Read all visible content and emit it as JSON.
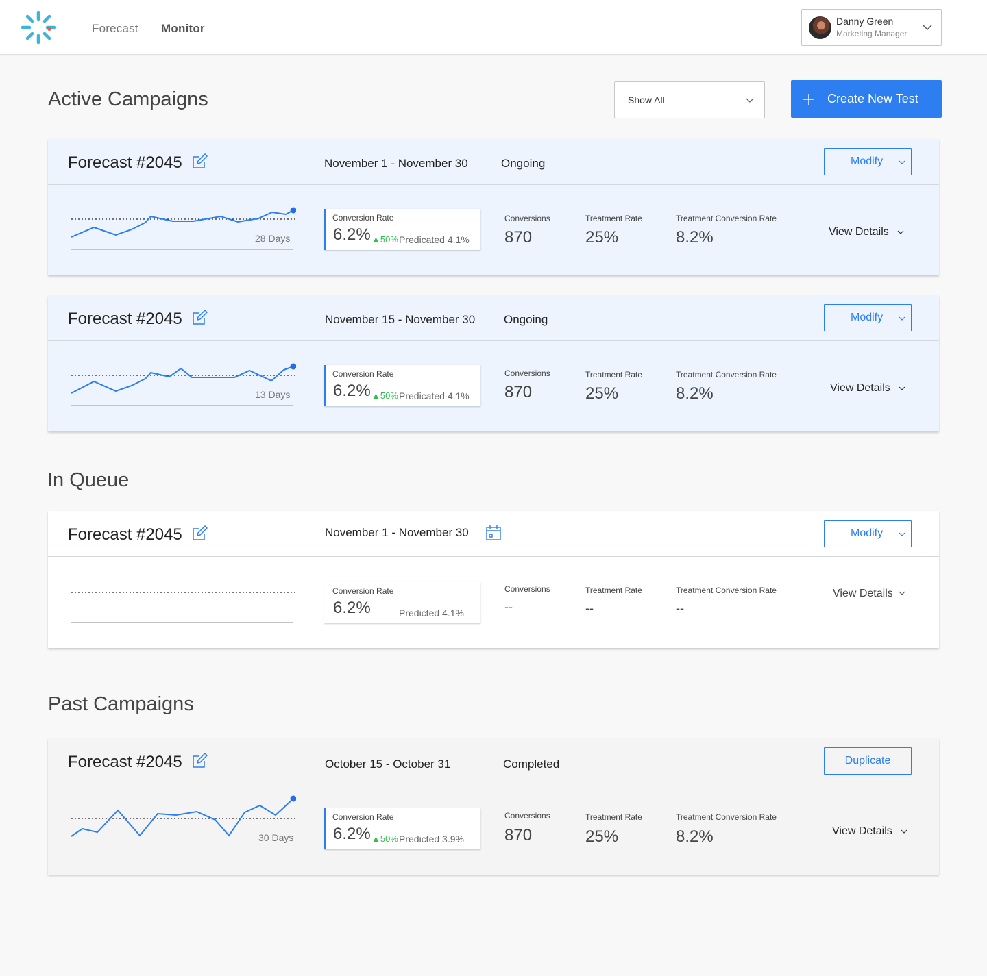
{
  "nav": {
    "forecast": "Forecast",
    "monitor": "Monitor"
  },
  "user": {
    "name": "Danny Green",
    "role": "Marketing Manager"
  },
  "sections": {
    "active": "Active Campaigns",
    "queue": "In Queue",
    "past": "Past Campaigns"
  },
  "filter": {
    "value": "Show All"
  },
  "create_button": "Create New Test",
  "metric_labels": {
    "conversion_rate": "Conversion Rate",
    "conversions": "Conversions",
    "treatment_rate": "Treatment Rate",
    "treatment_conversion_rate": "Treatment Conversion Rate",
    "view_details": "View Details"
  },
  "campaigns": [
    {
      "title": "Forecast #2045",
      "dates": "November 1 - November 30",
      "status": "Ongoing",
      "action": "Modify",
      "days": "28 Days",
      "conversion_rate": "6.2%",
      "delta": "50%",
      "predicted": "Predicated 4.1%",
      "conversions": "870",
      "treatment_rate": "25%",
      "treatment_conversion_rate": "8.2%"
    },
    {
      "title": "Forecast #2045",
      "dates": "November 15 - November 30",
      "status": "Ongoing",
      "action": "Modify",
      "days": "13 Days",
      "conversion_rate": "6.2%",
      "delta": "50%",
      "predicted": "Predicated 4.1%",
      "conversions": "870",
      "treatment_rate": "25%",
      "treatment_conversion_rate": "8.2%"
    },
    {
      "title": "Forecast #2045",
      "dates": "November 1 - November 30",
      "status": "",
      "action": "Modify",
      "days": "",
      "conversion_rate": "6.2%",
      "delta": "",
      "predicted": "Predicted 4.1%",
      "conversions": "--",
      "treatment_rate": "--",
      "treatment_conversion_rate": "--"
    },
    {
      "title": "Forecast #2045",
      "dates": "October 15 - October 31",
      "status": "Completed",
      "action": "Duplicate",
      "days": "30 Days",
      "conversion_rate": "6.2%",
      "delta": "50%",
      "predicted": "Predicted 3.9%",
      "conversions": "870",
      "treatment_rate": "25%",
      "treatment_conversion_rate": "8.2%"
    }
  ],
  "icons": {
    "logo": "sparkle-logo-icon",
    "edit": "edit-icon",
    "calendar": "calendar-icon",
    "chevron": "chevron-down-icon",
    "plus": "plus-icon",
    "delta": "triangle-up-icon"
  },
  "colors": {
    "accent": "#2d7ef0",
    "positive": "#2fbf4f",
    "active_card": "#edf4fd",
    "past_card": "#f4f4f4",
    "logo": "#3bb6d8"
  }
}
